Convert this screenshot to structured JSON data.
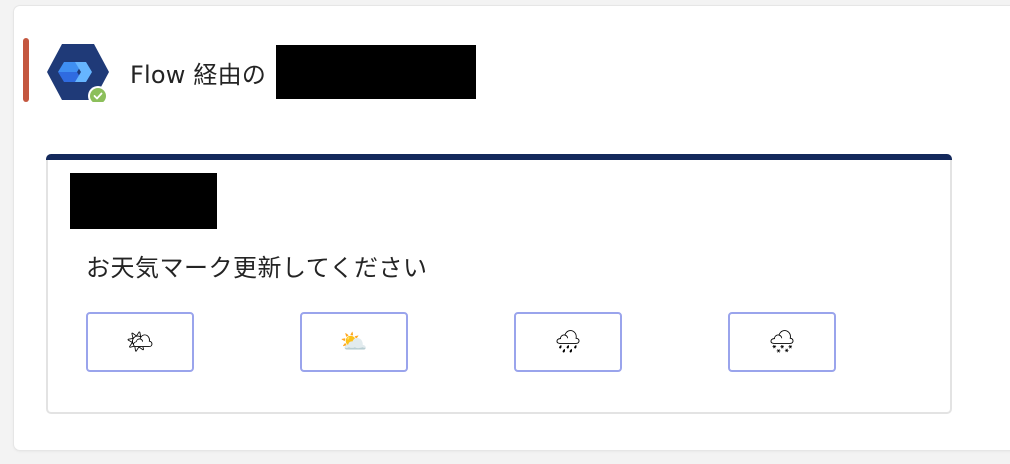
{
  "header": {
    "sender_prefix": "Flow 経由の"
  },
  "card": {
    "body_text": "お天気マーク更新してください",
    "buttons": [
      {
        "icon": "sun-behind-cloud-icon",
        "glyph": "🌤"
      },
      {
        "icon": "sun-behind-large-cloud-icon",
        "glyph": "⛅"
      },
      {
        "icon": "cloud-with-rain-icon",
        "glyph": "🌧"
      },
      {
        "icon": "cloud-with-snow-icon",
        "glyph": "🌨"
      }
    ]
  },
  "colors": {
    "accent_bar": "#c4573f",
    "card_header": "#14295c",
    "button_border": "#9aa4ec",
    "status_badge": "#8cbf5b"
  }
}
